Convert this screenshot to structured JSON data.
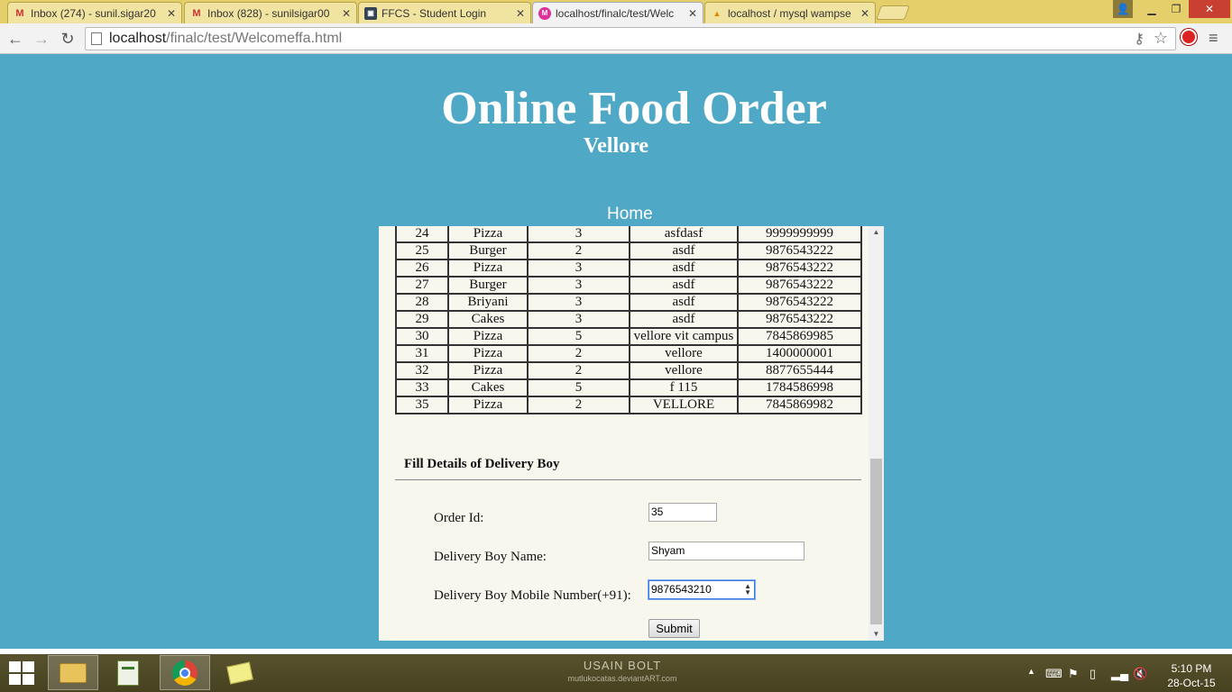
{
  "browser": {
    "tabs": [
      {
        "title": "Inbox (274) - sunil.sigar20",
        "icon": "gmail-icon",
        "active": false
      },
      {
        "title": "Inbox (828) - sunilsigar00",
        "icon": "gmail-icon",
        "active": false
      },
      {
        "title": "FFCS - Student Login",
        "icon": "site-icon",
        "active": false
      },
      {
        "title": "localhost/finalc/test/Welc",
        "icon": "page-icon",
        "active": true
      },
      {
        "title": "localhost / mysql wampse",
        "icon": "phpmyadmin-icon",
        "active": false
      }
    ],
    "url_host": "localhost",
    "url_path": "/finalc/test/Welcomeffa.html"
  },
  "header": {
    "title": "Online Food Order",
    "subtitle": "Vellore",
    "nav_home": "Home"
  },
  "orders": {
    "rows": [
      [
        "24",
        "Pizza",
        "3",
        "asfdasf",
        "9999999999"
      ],
      [
        "25",
        "Burger",
        "2",
        "asdf",
        "9876543222"
      ],
      [
        "26",
        "Pizza",
        "3",
        "asdf",
        "9876543222"
      ],
      [
        "27",
        "Burger",
        "3",
        "asdf",
        "9876543222"
      ],
      [
        "28",
        "Briyani",
        "3",
        "asdf",
        "9876543222"
      ],
      [
        "29",
        "Cakes",
        "3",
        "asdf",
        "9876543222"
      ],
      [
        "30",
        "Pizza",
        "5",
        "vellore vit campus",
        "7845869985"
      ],
      [
        "31",
        "Pizza",
        "2",
        "vellore",
        "1400000001"
      ],
      [
        "32",
        "Pizza",
        "2",
        "vellore",
        "8877655444"
      ],
      [
        "33",
        "Cakes",
        "5",
        "f 115",
        "1784586998"
      ],
      [
        "35",
        "Pizza",
        "2",
        "VELLORE",
        "7845869982"
      ]
    ]
  },
  "delivery_form": {
    "heading": "Fill Details of Delivery Boy",
    "order_id_label": "Order Id:",
    "order_id_value": "35",
    "name_label": "Delivery Boy Name:",
    "name_value": "Shyam",
    "mobile_label": "Delivery Boy Mobile Number(+91):",
    "mobile_value": "9876543210",
    "submit_label": "Submit"
  },
  "taskbar": {
    "wallpaper_title": "USAIN BOLT",
    "wallpaper_credit": "mutlukocatas.deviantART.com",
    "time": "5:10 PM",
    "date": "28-Oct-15"
  },
  "colors": {
    "page_background": "#4fa8c5",
    "panel_background": "#f8f7ee",
    "tabstrip": "#e5cf6b"
  }
}
